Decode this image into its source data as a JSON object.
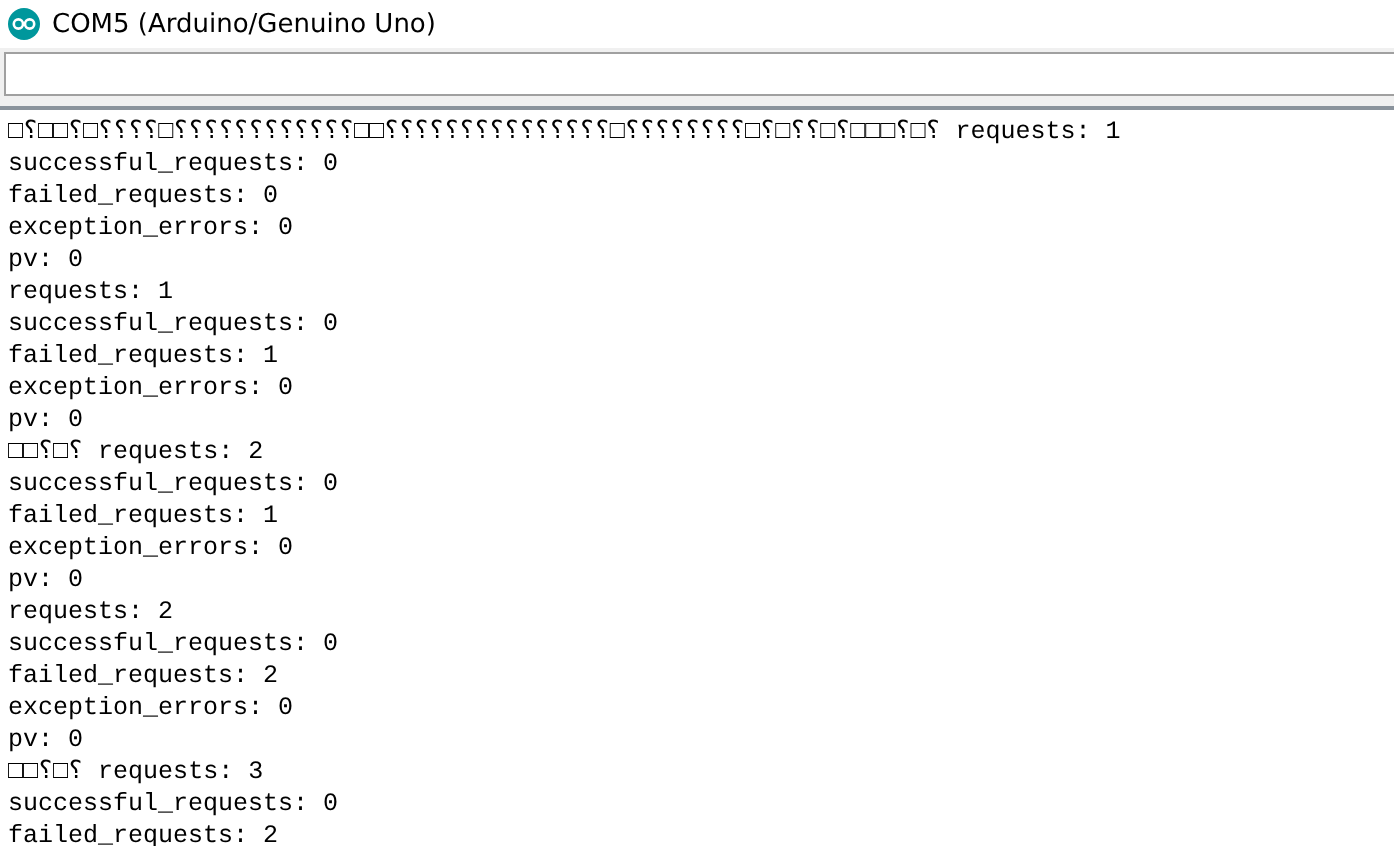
{
  "window": {
    "title": "COM5 (Arduino/Genuino Uno)"
  },
  "output": {
    "lines": [
      "□⸮□□⸮□⸮⸮⸮⸮□⸮⸮⸮⸮⸮⸮⸮⸮⸮⸮⸮⸮□□⸮⸮⸮⸮⸮⸮⸮⸮⸮⸮⸮⸮⸮⸮⸮□⸮⸮⸮⸮⸮⸮⸮⸮□⸮□⸮⸮□⸮□□□⸮□⸮ requests: 1",
      "successful_requests: 0",
      "failed_requests: 0",
      "exception_errors: 0",
      "pv: 0",
      "requests: 1",
      "successful_requests: 0",
      "failed_requests: 1",
      "exception_errors: 0",
      "pv: 0",
      "□□⸮□⸮ requests: 2",
      "successful_requests: 0",
      "failed_requests: 1",
      "exception_errors: 0",
      "pv: 0",
      "requests: 2",
      "successful_requests: 0",
      "failed_requests: 2",
      "exception_errors: 0",
      "pv: 0",
      "□□⸮□⸮ requests: 3",
      "successful_requests: 0",
      "failed_requests: 2"
    ]
  }
}
